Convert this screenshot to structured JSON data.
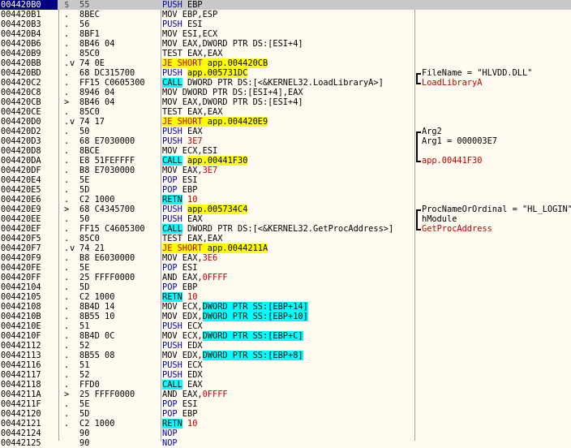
{
  "window": {
    "title": ""
  },
  "rows": [
    {
      "addr": "004420B0",
      "mark": "$",
      "jmp": "",
      "hex": "55",
      "mn": "PUSH",
      "ops": "EBP",
      "comment": "",
      "selected": true
    },
    {
      "addr": "004420B1",
      "mark": ".",
      "jmp": "",
      "hex": "8BEC",
      "mn": "MOV",
      "ops": "EBP,ESP",
      "comment": ""
    },
    {
      "addr": "004420B3",
      "mark": ".",
      "jmp": "",
      "hex": "56",
      "mn": "PUSH",
      "ops": "ESI",
      "comment": ""
    },
    {
      "addr": "004420B4",
      "mark": ".",
      "jmp": "",
      "hex": "8BF1",
      "mn": "MOV",
      "ops": "ESI,ECX",
      "comment": ""
    },
    {
      "addr": "004420B6",
      "mark": ".",
      "jmp": "",
      "hex": "8B46 04",
      "mn": "MOV",
      "ops": "EAX,DWORD PTR DS:[ESI+4]",
      "comment": ""
    },
    {
      "addr": "004420B9",
      "mark": ".",
      "jmp": "",
      "hex": "85C0",
      "mn": "TEST",
      "ops": "EAX,EAX",
      "comment": ""
    },
    {
      "addr": "004420BB",
      "mark": ".",
      "jmp": "v",
      "hex": "74 0E",
      "mn": "JE SHORT",
      "ops": "app.004420CB",
      "comment": "",
      "kind": "jcc"
    },
    {
      "addr": "004420BD",
      "mark": ".",
      "jmp": "",
      "hex": "68 DC315700",
      "mn": "PUSH",
      "ops": "app.005731DC",
      "comment": "FileName = \"HLVDD.DLL\"",
      "kind": "push-hl",
      "br": "top"
    },
    {
      "addr": "004420C2",
      "mark": ".",
      "jmp": "",
      "hex": "FF15 C0605300",
      "mn": "CALL",
      "ops": "DWORD PTR DS:[<&KERNEL32.LoadLibraryA>]",
      "comment": "LoadLibraryA",
      "kind": "call-api",
      "br": "bot",
      "ctype": "api"
    },
    {
      "addr": "004420C8",
      "mark": ".",
      "jmp": "",
      "hex": "8946 04",
      "mn": "MOV",
      "ops": "DWORD PTR DS:[ESI+4],EAX",
      "comment": ""
    },
    {
      "addr": "004420CB",
      "mark": ">",
      "jmp": "",
      "hex": "8B46 04",
      "mn": "MOV",
      "ops": "EAX,DWORD PTR DS:[ESI+4]",
      "comment": ""
    },
    {
      "addr": "004420CE",
      "mark": ".",
      "jmp": "",
      "hex": "85C0",
      "mn": "TEST",
      "ops": "EAX,EAX",
      "comment": ""
    },
    {
      "addr": "004420D0",
      "mark": ".",
      "jmp": "v",
      "hex": "74 17",
      "mn": "JE SHORT",
      "ops": "app.004420E9",
      "comment": "",
      "kind": "jcc"
    },
    {
      "addr": "004420D2",
      "mark": ".",
      "jmp": "",
      "hex": "50",
      "mn": "PUSH",
      "ops": "EAX",
      "comment": "Arg2",
      "br": "top"
    },
    {
      "addr": "004420D3",
      "mark": ".",
      "jmp": "",
      "hex": "68 E7030000",
      "mn": "PUSH",
      "ops": "3E7",
      "comment": "Arg1 = 000003E7",
      "kind": "push-num",
      "br": "mid"
    },
    {
      "addr": "004420D8",
      "mark": ".",
      "jmp": "",
      "hex": "8BCE",
      "mn": "MOV",
      "ops": "ECX,ESI",
      "comment": "",
      "br": "mid"
    },
    {
      "addr": "004420DA",
      "mark": ".",
      "jmp": "",
      "hex": "E8 51FEFFFF",
      "mn": "CALL",
      "ops": "app.00441F30",
      "comment": "app.00441F30",
      "kind": "call-hl",
      "br": "bot",
      "ctype": "call"
    },
    {
      "addr": "004420DF",
      "mark": ".",
      "jmp": "",
      "hex": "B8 E7030000",
      "mn": "MOV",
      "ops": "EAX,3E7",
      "comment": "",
      "kind": "mov-num",
      "num": "3E7",
      "pre": "EAX,"
    },
    {
      "addr": "004420E4",
      "mark": ".",
      "jmp": "",
      "hex": "5E",
      "mn": "POP",
      "ops": "ESI",
      "comment": ""
    },
    {
      "addr": "004420E5",
      "mark": ".",
      "jmp": "",
      "hex": "5D",
      "mn": "POP",
      "ops": "EBP",
      "comment": ""
    },
    {
      "addr": "004420E6",
      "mark": ".",
      "jmp": "",
      "hex": "C2 1000",
      "mn": "RETN",
      "ops": "10",
      "comment": "",
      "kind": "retn"
    },
    {
      "addr": "004420E9",
      "mark": ">",
      "jmp": "",
      "hex": "68 C4345700",
      "mn": "PUSH",
      "ops": "app.005734C4",
      "comment": "ProcNameOrOrdinal = \"HL_LOGIN\"",
      "kind": "push-hl",
      "br": "top"
    },
    {
      "addr": "004420EE",
      "mark": ".",
      "jmp": "",
      "hex": "50",
      "mn": "PUSH",
      "ops": "EAX",
      "comment": "hModule",
      "br": "mid"
    },
    {
      "addr": "004420EF",
      "mark": ".",
      "jmp": "",
      "hex": "FF15 C4605300",
      "mn": "CALL",
      "ops": "DWORD PTR DS:[<&KERNEL32.GetProcAddress>]",
      "comment": "GetProcAddress",
      "kind": "call-api",
      "br": "bot",
      "ctype": "api"
    },
    {
      "addr": "004420F5",
      "mark": ".",
      "jmp": "",
      "hex": "85C0",
      "mn": "TEST",
      "ops": "EAX,EAX",
      "comment": ""
    },
    {
      "addr": "004420F7",
      "mark": ".",
      "jmp": "v",
      "hex": "74 21",
      "mn": "JE SHORT",
      "ops": "app.0044211A",
      "comment": "",
      "kind": "jcc"
    },
    {
      "addr": "004420F9",
      "mark": ".",
      "jmp": "",
      "hex": "B8 E6030000",
      "mn": "MOV",
      "ops": "EAX,3E6",
      "comment": "",
      "kind": "mov-num",
      "num": "3E6",
      "pre": "EAX,"
    },
    {
      "addr": "004420FE",
      "mark": ".",
      "jmp": "",
      "hex": "5E",
      "mn": "POP",
      "ops": "ESI",
      "comment": ""
    },
    {
      "addr": "004420FF",
      "mark": ".",
      "jmp": "",
      "hex": "25 FFFF0000",
      "mn": "AND",
      "ops": "EAX,0FFFF",
      "comment": "",
      "kind": "mov-num",
      "num": "0FFFF",
      "pre": "EAX,"
    },
    {
      "addr": "00442104",
      "mark": ".",
      "jmp": "",
      "hex": "5D",
      "mn": "POP",
      "ops": "EBP",
      "comment": ""
    },
    {
      "addr": "00442105",
      "mark": ".",
      "jmp": "",
      "hex": "C2 1000",
      "mn": "RETN",
      "ops": "10",
      "comment": "",
      "kind": "retn"
    },
    {
      "addr": "00442108",
      "mark": ".",
      "jmp": "",
      "hex": "8B4D 14",
      "mn": "MOV",
      "ops": "ECX,DWORD PTR SS:[EBP+14]",
      "comment": "",
      "kind": "mov-ss",
      "pre": "ECX,",
      "mem": "DWORD PTR SS:[EBP+14]"
    },
    {
      "addr": "0044210B",
      "mark": ".",
      "jmp": "",
      "hex": "8B55 10",
      "mn": "MOV",
      "ops": "EDX,DWORD PTR SS:[EBP+10]",
      "comment": "",
      "kind": "mov-ss",
      "pre": "EDX,",
      "mem": "DWORD PTR SS:[EBP+10]"
    },
    {
      "addr": "0044210E",
      "mark": ".",
      "jmp": "",
      "hex": "51",
      "mn": "PUSH",
      "ops": "ECX",
      "comment": ""
    },
    {
      "addr": "0044210F",
      "mark": ".",
      "jmp": "",
      "hex": "8B4D 0C",
      "mn": "MOV",
      "ops": "ECX,DWORD PTR SS:[EBP+C]",
      "comment": "",
      "kind": "mov-ss",
      "pre": "ECX,",
      "mem": "DWORD PTR SS:[EBP+C]"
    },
    {
      "addr": "00442112",
      "mark": ".",
      "jmp": "",
      "hex": "52",
      "mn": "PUSH",
      "ops": "EDX",
      "comment": ""
    },
    {
      "addr": "00442113",
      "mark": ".",
      "jmp": "",
      "hex": "8B55 08",
      "mn": "MOV",
      "ops": "EDX,DWORD PTR SS:[EBP+8]",
      "comment": "",
      "kind": "mov-ss",
      "pre": "EDX,",
      "mem": "DWORD PTR SS:[EBP+8]"
    },
    {
      "addr": "00442116",
      "mark": ".",
      "jmp": "",
      "hex": "51",
      "mn": "PUSH",
      "ops": "ECX",
      "comment": ""
    },
    {
      "addr": "00442117",
      "mark": ".",
      "jmp": "",
      "hex": "52",
      "mn": "PUSH",
      "ops": "EDX",
      "comment": ""
    },
    {
      "addr": "00442118",
      "mark": ".",
      "jmp": "",
      "hex": "FFD0",
      "mn": "CALL",
      "ops": "EAX",
      "comment": "",
      "kind": "call-reg"
    },
    {
      "addr": "0044211A",
      "mark": ">",
      "jmp": "",
      "hex": "25 FFFF0000",
      "mn": "AND",
      "ops": "EAX,0FFFF",
      "comment": "",
      "kind": "mov-num",
      "num": "0FFFF",
      "pre": "EAX,"
    },
    {
      "addr": "0044211F",
      "mark": ".",
      "jmp": "",
      "hex": "5E",
      "mn": "POP",
      "ops": "ESI",
      "comment": ""
    },
    {
      "addr": "00442120",
      "mark": ".",
      "jmp": "",
      "hex": "5D",
      "mn": "POP",
      "ops": "EBP",
      "comment": ""
    },
    {
      "addr": "00442121",
      "mark": ".",
      "jmp": "",
      "hex": "C2 1000",
      "mn": "RETN",
      "ops": "10",
      "comment": "",
      "kind": "retn"
    },
    {
      "addr": "00442124",
      "mark": "",
      "jmp": "",
      "hex": "90",
      "mn": "NOP",
      "ops": "",
      "comment": ""
    },
    {
      "addr": "00442125",
      "mark": "",
      "jmp": "",
      "hex": "90",
      "mn": "NOP",
      "ops": "",
      "comment": ""
    }
  ],
  "colors": {
    "background": "#fffbf0",
    "highlight_yellow": "#ffff00",
    "highlight_cyan": "#00ffff",
    "api_red": "#c00000",
    "selection": "#000080"
  }
}
